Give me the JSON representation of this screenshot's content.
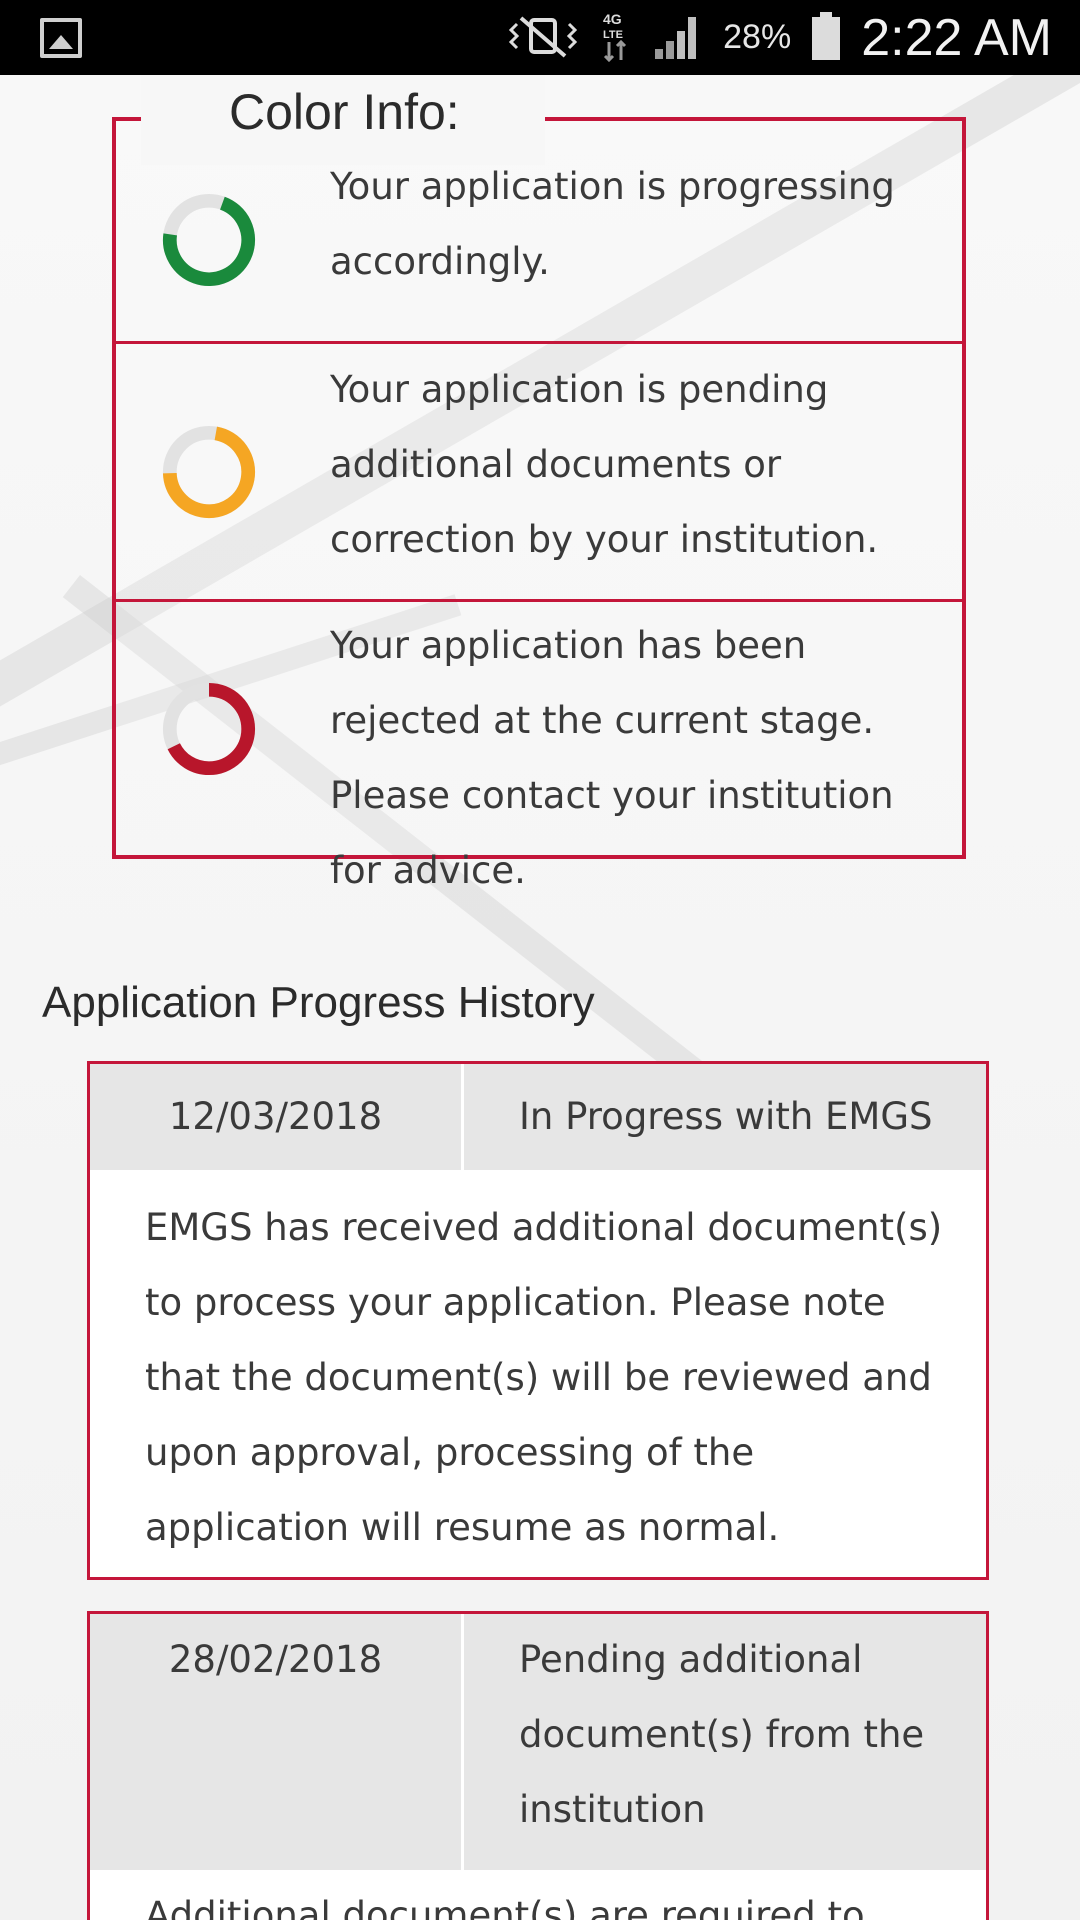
{
  "status_bar": {
    "battery_percent": "28%",
    "time": "2:22 AM",
    "network": "4G LTE",
    "icons": [
      "gallery-icon",
      "vibrate-off-icon",
      "lte-icon",
      "signal-icon",
      "battery-icon"
    ]
  },
  "color_info": {
    "title": "Color Info:",
    "items": [
      {
        "color": "#1a8a3c",
        "text": "Your application is progressing accordingly."
      },
      {
        "color": "#f5a623",
        "text": "Your application is pending additional documents or correction by your institution."
      },
      {
        "color": "#b8162b",
        "text": "Your application has been rejected at the current stage. Please contact your institution for advice."
      }
    ],
    "border_color": "#c4163a"
  },
  "history": {
    "title": "Application Progress History",
    "entries": [
      {
        "date": "12/03/2018",
        "status": "In Progress with EMGS",
        "description": "EMGS has received additional document(s) to process your application. Please note that the document(s) will be reviewed and upon approval, processing of the application will resume as normal."
      },
      {
        "date": "28/02/2018",
        "status": "Pending additional document(s) from the institution",
        "description": "Additional document(s) are required to"
      }
    ]
  }
}
